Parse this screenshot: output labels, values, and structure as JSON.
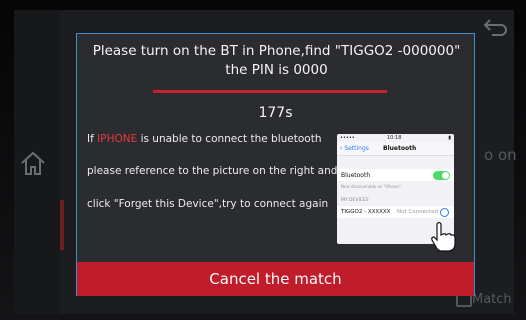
{
  "background": {
    "right_text": "o on",
    "bottom_right_text": "Match"
  },
  "dialog": {
    "title_line1": "Please turn on the BT in Phone,find \"TIGGO2 -000000\"",
    "title_line2": "the PIN is 0000",
    "countdown": "177s",
    "instruction": {
      "line1_prefix": "If",
      "line1_highlight": "IPHONE",
      "line1_suffix": "is unable to connect the bluetooth",
      "line2": "please reference to the picture on the right and",
      "line3": "click \"Forget this Device\",try to connect again"
    },
    "phone_image": {
      "status_left": "•••••",
      "status_time": "10:18",
      "back_label": "Settings",
      "screen_title": "Bluetooth",
      "bluetooth_row": "Bluetooth",
      "bluetooth_on": true,
      "discoverable_text": "Now discoverable as \"iPhone\".",
      "section_header": "MY DEVICES",
      "device_name": "TIGGO2 - XXXXXX",
      "device_status": "Not Connected"
    },
    "cancel_label": "Cancel the match"
  },
  "colors": {
    "accent_red": "#c01c2c",
    "highlight_red": "#e63a3e",
    "dialog_border": "#3f8fc7",
    "dialog_bg": "#2b2c30"
  }
}
